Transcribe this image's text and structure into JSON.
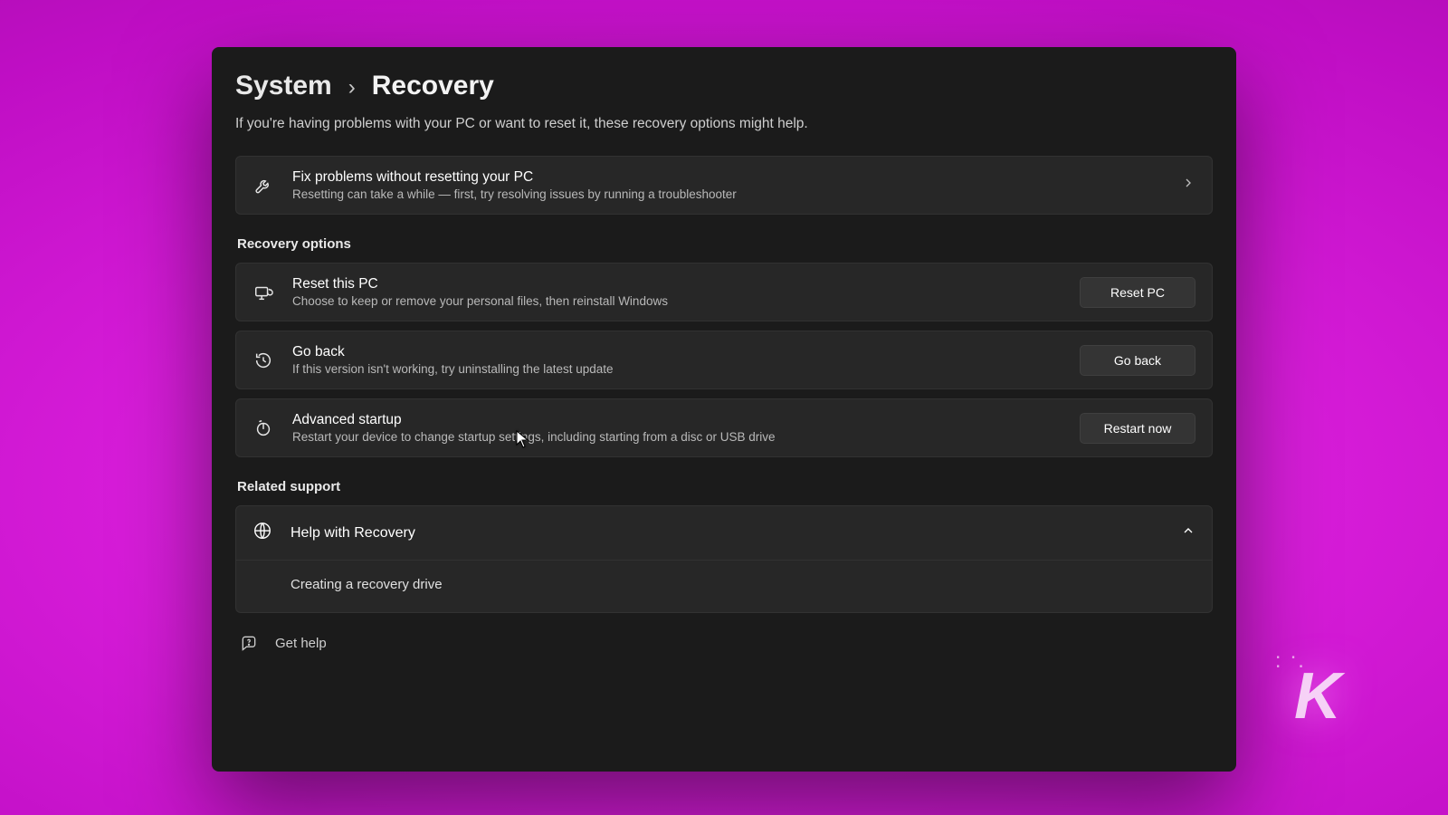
{
  "breadcrumb": {
    "parent": "System",
    "separator": "›",
    "current": "Recovery"
  },
  "subtitle": "If you're having problems with your PC or want to reset it, these recovery options might help.",
  "fix_row": {
    "title": "Fix problems without resetting your PC",
    "desc": "Resetting can take a while — first, try resolving issues by running a troubleshooter"
  },
  "sections": {
    "recovery_label": "Recovery options",
    "related_label": "Related support"
  },
  "reset_row": {
    "title": "Reset this PC",
    "desc": "Choose to keep or remove your personal files, then reinstall Windows",
    "button": "Reset PC"
  },
  "goback_row": {
    "title": "Go back",
    "desc": "If this version isn't working, try uninstalling the latest update",
    "button": "Go back"
  },
  "adv_row": {
    "title": "Advanced startup",
    "desc": "Restart your device to change startup settings, including starting from a disc or USB drive",
    "button": "Restart now"
  },
  "help_card": {
    "title": "Help with Recovery",
    "link": "Creating a recovery drive"
  },
  "get_help": "Get help",
  "watermark": "K"
}
